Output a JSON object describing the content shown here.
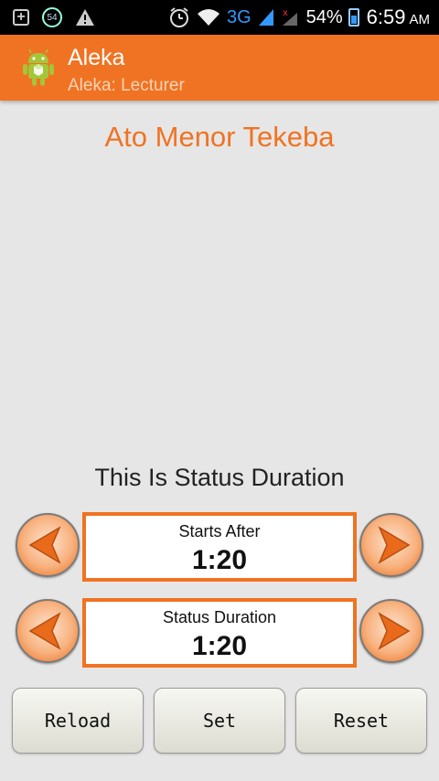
{
  "status_bar": {
    "notification_badge": "54",
    "network_type": "3G",
    "battery_percent": "54%",
    "time": "6:59",
    "ampm": "AM",
    "icons": [
      "plus-box-icon",
      "badge-icon",
      "warning-icon",
      "alarm-icon",
      "wifi-icon",
      "signal-icon",
      "no-signal-icon",
      "battery-icon"
    ]
  },
  "action_bar": {
    "title": "Aleka",
    "subtitle": "Aleka: Lecturer",
    "app_icon": "android-icon"
  },
  "lecturer_name": "Ato Menor Tekeba",
  "section_title": "This Is Status Duration",
  "timers": [
    {
      "label": "Starts After",
      "value": "1:20"
    },
    {
      "label": "Status Duration",
      "value": "1:20"
    }
  ],
  "buttons": {
    "reload": "Reload",
    "set": "Set",
    "reset": "Reset"
  },
  "colors": {
    "accent": "#f07323",
    "background": "#e6e6e6"
  }
}
